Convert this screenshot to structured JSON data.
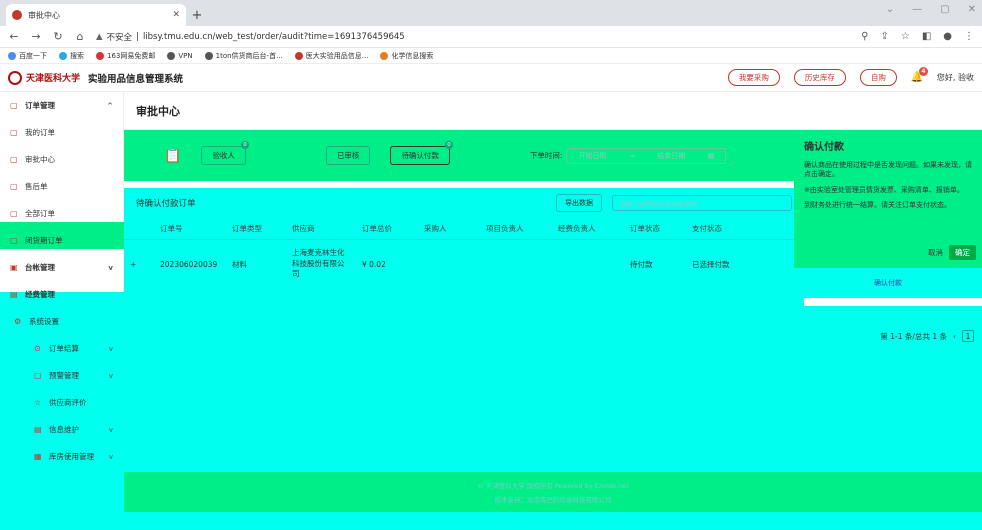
{
  "browser": {
    "tab_title": "审批中心",
    "url_warning": "不安全",
    "url": "libsy.tmu.edu.cn/web_test/order/audit?time=1691376459645",
    "bookmarks": [
      "百度一下",
      "搜索",
      "163网易免费邮",
      "VPN",
      "1ton供货商后台-首...",
      "医大实验用品信息...",
      "化学信息搜索"
    ]
  },
  "header": {
    "brand": "天津医科大学",
    "system_title": "实验用品信息管理系统",
    "buttons": [
      "我要采购",
      "历史库存",
      "自购"
    ],
    "notification_count": "4",
    "greeting": "您好, 验收"
  },
  "sidebar": {
    "items": [
      {
        "label": "订单管理",
        "type": "group",
        "caret": "^"
      },
      {
        "label": "我的订单",
        "type": "sub"
      },
      {
        "label": "审批中心",
        "type": "sub"
      },
      {
        "label": "售后单",
        "type": "sub"
      },
      {
        "label": "全部订单",
        "type": "sub"
      },
      {
        "label": "闭货期订单",
        "type": "sub"
      },
      {
        "label": "台帐管理",
        "type": "group",
        "caret": "v"
      },
      {
        "label": "经费管理",
        "type": "group"
      },
      {
        "label": "系统设置",
        "type": "sub"
      },
      {
        "label": "订单结算",
        "type": "sub2",
        "caret": "v"
      },
      {
        "label": "预警管理",
        "type": "sub2",
        "caret": "v"
      },
      {
        "label": "供应商评价",
        "type": "sub2"
      },
      {
        "label": "信息维护",
        "type": "sub2",
        "caret": "v"
      },
      {
        "label": "库房使用管理",
        "type": "sub2",
        "caret": "v"
      }
    ]
  },
  "main": {
    "page_title": "审批中心",
    "filters": {
      "tabs": [
        {
          "label": "验收人",
          "badge": "0"
        },
        {
          "label": "已审核",
          "badge": ""
        },
        {
          "label": "待确认付款",
          "badge": "0"
        }
      ],
      "date_label": "下单时间:",
      "date_start": "开始日期",
      "date_sep": "→",
      "date_end": "结束日期"
    },
    "table": {
      "title": "待确认付款订单",
      "export_label": "导出数据",
      "search_placeholder": "请输入自购供应商名称查询",
      "headers": [
        "订单号",
        "订单类型",
        "供应商",
        "订单总价",
        "采购人",
        "项目负责人",
        "经费负责人",
        "订单状态",
        "支付状态"
      ],
      "rows": [
        {
          "expand": "+",
          "order_no": "202306020039",
          "type": "材料",
          "supplier": "上海麦克林生化科技股份有限公司",
          "total": "¥ 0.02",
          "buyer": "",
          "pm": "",
          "fund": "",
          "status": "待付款",
          "pay": "已选择付款"
        }
      ]
    },
    "pager": {
      "summary": "第 1-1 条/总共 1 条",
      "page": "1"
    },
    "footer": {
      "copyright": "© 天津医科大学 版权所有 Powered by Ezelab.net",
      "support": "技术支持：北京库巴科信息科技有限公司"
    }
  },
  "dialog": {
    "title": "确认付款",
    "lines": [
      "确认商品在使用过程中是否发现问题。如果未发现，请点击确定。",
      "※由实验室处管理员情货发票、采购清单、报销单。",
      "到财务处进行统一结算。请关注订单支付状态。"
    ],
    "cancel": "取消",
    "ok": "确定",
    "link": "确认付款"
  }
}
